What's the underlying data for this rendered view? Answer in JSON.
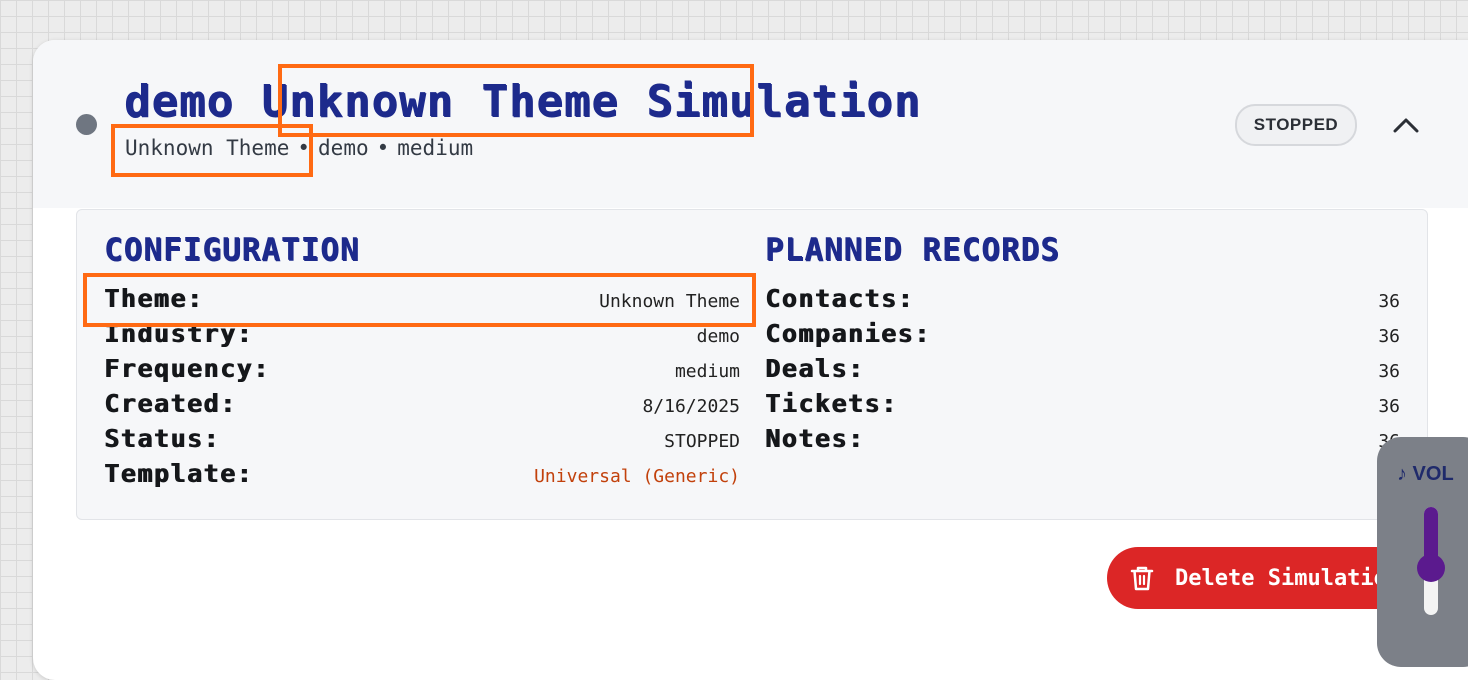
{
  "header": {
    "title": "demo Unknown Theme Simulation",
    "subtitle": {
      "theme": "Unknown Theme",
      "industry": "demo",
      "frequency": "medium",
      "separator": "•"
    },
    "status_badge": "STOPPED",
    "collapse_icon": "chevron-up-icon"
  },
  "configuration": {
    "title": "CONFIGURATION",
    "rows": [
      {
        "label": "Theme:",
        "value": "Unknown Theme"
      },
      {
        "label": "Industry:",
        "value": "demo"
      },
      {
        "label": "Frequency:",
        "value": "medium"
      },
      {
        "label": "Created:",
        "value": "8/16/2025"
      },
      {
        "label": "Status:",
        "value": "STOPPED"
      },
      {
        "label": "Template:",
        "value": "Universal (Generic)"
      }
    ]
  },
  "planned_records": {
    "title": "PLANNED RECORDS",
    "rows": [
      {
        "label": "Contacts:",
        "value": "36"
      },
      {
        "label": "Companies:",
        "value": "36"
      },
      {
        "label": "Deals:",
        "value": "36"
      },
      {
        "label": "Tickets:",
        "value": "36"
      },
      {
        "label": "Notes:",
        "value": "36"
      }
    ]
  },
  "actions": {
    "delete_label": "Delete Simulation",
    "delete_icon": "trash-icon"
  },
  "volume": {
    "label": "♪ VOL",
    "level": 0.6
  },
  "colors": {
    "accent_navy": "#1d2a8c",
    "danger_red": "#dc2626",
    "template_orange": "#c2410c",
    "highlight_orange": "#ff6a13",
    "volume_purple": "#5b1a8e"
  }
}
